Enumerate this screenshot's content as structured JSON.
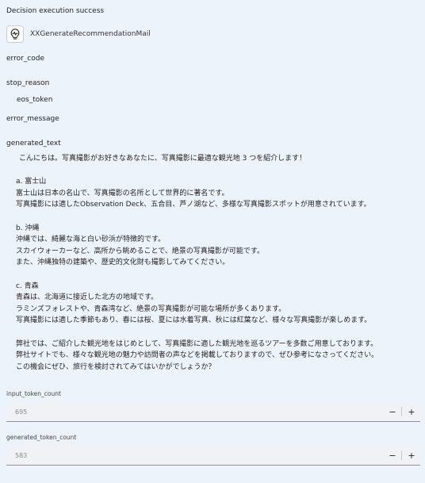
{
  "status_text": "Decision execution success",
  "node": {
    "name": "XXGenerateRecommendationMail",
    "icon": "lightbulb-icon"
  },
  "fields": {
    "error_code": {
      "label": "error_code",
      "value": ""
    },
    "stop_reason": {
      "label": "stop_reason",
      "value": "eos_token"
    },
    "error_message": {
      "label": "error_message",
      "value": ""
    },
    "generated_text": {
      "label": "generated_text",
      "lines": [
        "こんにちは。写真撮影がお好きなあなたに、写真撮影に最適な観光地 3 つを紹介します！",
        "",
        "a. 富士山",
        "富士山は日本の名山で、写真撮影の名所として世界的に著名です。",
        "写真撮影には適したObservation Deck、五合目、芦ノ湖など、多様な写真撮影スポットが用意されています。",
        "",
        "b. 沖縄",
        "沖縄では、綺麗な海と白い砂浜が特徴的です。",
        "スカイウォーカーなど、高所から眺めることで、絶景の写真撮影が可能です。",
        "また、沖縄独特の建築や、歴史的文化財も撮影してみてください。",
        "",
        "c. 青森",
        "青森は、北海道に接近した北方の地域です。",
        "ラミンズフォレストや、青森湾など、絶景の写真撮影が可能な場所が多くあります。",
        "写真撮影には適した季節もあり、春には桜、夏には水着写真、秋には紅葉など、様々な写真撮影が楽しめます。",
        "",
        "弊社では、ご紹介した観光地をはじめとして、写真撮影に適した観光地を巡るツアーを多数ご用意しております。",
        "弊社サイトでも、様々な観光地の魅力や訪問者の声などを掲載しておりますので、ぜひ参考になさってください。",
        "この機会にぜひ、旅行を検討されてみてはいかがでしょうか？"
      ]
    },
    "input_token_count": {
      "label": "input_token_count",
      "value": "695"
    },
    "generated_token_count": {
      "label": "generated_token_count",
      "value": "583"
    }
  },
  "stepper": {
    "minus": "−",
    "plus": "+"
  }
}
